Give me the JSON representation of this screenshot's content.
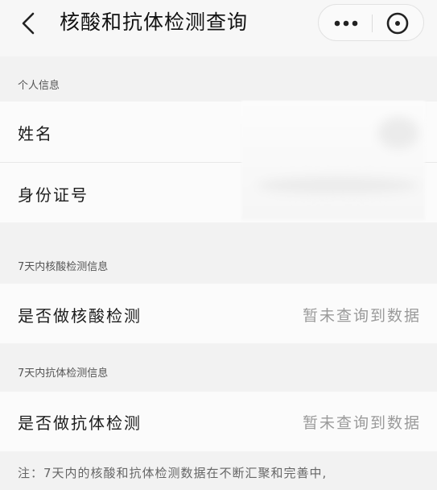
{
  "header": {
    "title": "核酸和抗体检测查询",
    "back_icon": "chevron-left-icon",
    "more_icon": "more-dots-icon",
    "close_icon": "close-circle-icon"
  },
  "personal": {
    "section_title": "个人信息",
    "name_label": "姓名",
    "id_label": "身份证号"
  },
  "nucleic": {
    "section_title": "7天内核酸检测信息",
    "label": "是否做核酸检测",
    "value": "暂未查询到数据"
  },
  "antibody": {
    "section_title": "7天内抗体检测信息",
    "label": "是否做抗体检测",
    "value": "暂未查询到数据"
  },
  "footer": {
    "note": "注：7天内的核酸和抗体检测数据在不断汇聚和完善中,"
  }
}
